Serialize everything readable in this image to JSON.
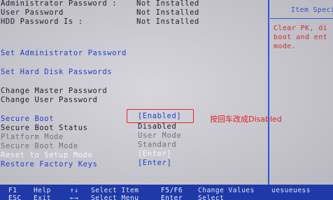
{
  "security": {
    "admin_password": {
      "label": "Administrator Password :",
      "value": "Not Installed"
    },
    "user_password": {
      "label": "User Password",
      "value": "Not Installed"
    },
    "hdd_password": {
      "label": "HDD Password Is :",
      "value": "Not Installed"
    },
    "set_admin_password": "Set Administrator Password",
    "set_hdd_passwords": "Set Hard Disk Passwords",
    "change_master_password": "Change Master Password",
    "change_user_password": "Change User Password",
    "secure_boot": {
      "label": "Secure Boot",
      "value": "[Enabled]"
    },
    "secure_boot_status": {
      "label": "Secure Boot Status",
      "value": "Disabled"
    },
    "platform_mode": {
      "label": "Platform Mode",
      "value": "User Mode"
    },
    "secure_boot_mode": {
      "label": "Secure Boot Mode",
      "value": "Standard"
    },
    "reset_setup_mode": {
      "label": "Reset to Setup Mode",
      "value": "[Enter]"
    },
    "restore_factory_keys": {
      "label": "Restore Factory Keys",
      "value": "[Enter]"
    }
  },
  "help_panel": {
    "title": "Item Speci",
    "lines": [
      "Clear PK, di",
      "boot and ent",
      "mode."
    ]
  },
  "annotation": "按回车改成Disabled",
  "footer": {
    "row1": [
      {
        "key": "F1",
        "label": "Help"
      },
      {
        "key": "↑↓",
        "label": "Select Item"
      },
      {
        "key": "F5/F6",
        "label": "Change Values"
      },
      {
        "key": "",
        "label": "uesueuess"
      }
    ],
    "row2": [
      {
        "key": "ESC",
        "label": "Exit"
      },
      {
        "key": "←→",
        "label": "Select Menu"
      },
      {
        "key": "Enter",
        "label": "Select"
      }
    ]
  },
  "colors": {
    "accent_blue": "#1d3fd0",
    "highlight_red": "#e0262c",
    "footer_bg": "#1f3aa8"
  }
}
